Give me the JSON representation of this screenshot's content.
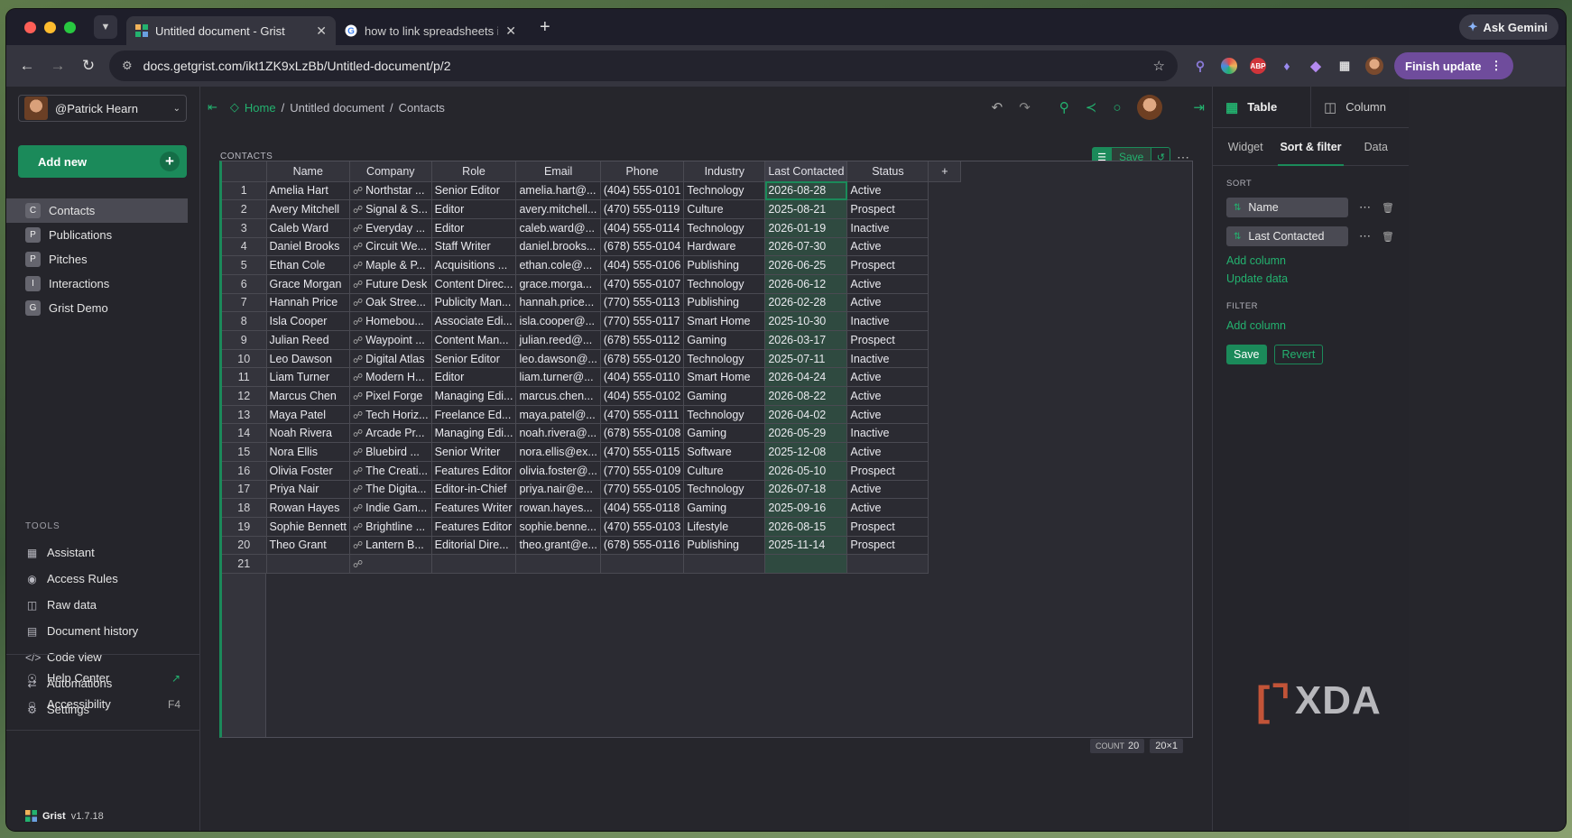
{
  "browser": {
    "tabs": [
      {
        "title": "Untitled document - Grist",
        "active": true
      },
      {
        "title": "how to link spreadsheets in g",
        "active": false
      }
    ],
    "gemini_label": "Ask Gemini",
    "url": "docs.getgrist.com/ikt1ZK9xLzBb/Untitled-document/p/2",
    "finish_update": "Finish update"
  },
  "left_panel": {
    "account": "@Patrick Hearn",
    "add_new": "Add new",
    "pages": [
      {
        "icon": "C",
        "label": "Contacts",
        "selected": true
      },
      {
        "icon": "P",
        "label": "Publications"
      },
      {
        "icon": "P",
        "label": "Pitches"
      },
      {
        "icon": "I",
        "label": "Interactions"
      },
      {
        "icon": "G",
        "label": "Grist Demo"
      }
    ],
    "tools_title": "TOOLS",
    "tools": [
      {
        "label": "Assistant"
      },
      {
        "label": "Access Rules"
      },
      {
        "label": "Raw data"
      },
      {
        "label": "Document history"
      },
      {
        "label": "Code view"
      },
      {
        "label": "Automations"
      },
      {
        "label": "Settings"
      }
    ],
    "help_center": "Help Center",
    "accessibility": "Accessibility",
    "accessibility_shortcut": "F4",
    "brand": "Grist",
    "version": "v1.7.18"
  },
  "breadcrumbs": {
    "home": "Home",
    "doc": "Untitled document",
    "page": "Contacts",
    "sep": "/"
  },
  "section": {
    "title": "CONTACTS",
    "save": "Save",
    "columns": [
      "Name",
      "Company",
      "Role",
      "Email",
      "Phone",
      "Industry",
      "Last Contacted",
      "Status"
    ],
    "add_column": "+",
    "rows": [
      [
        "1",
        "Amelia Hart",
        "Northstar ...",
        "Senior Editor",
        "amelia.hart@...",
        "(404) 555-0101",
        "Technology",
        "2026-08-28",
        "Active"
      ],
      [
        "2",
        "Avery Mitchell",
        "Signal & S...",
        "Editor",
        "avery.mitchell...",
        "(470) 555-0119",
        "Culture",
        "2025-08-21",
        "Prospect"
      ],
      [
        "3",
        "Caleb Ward",
        "Everyday ...",
        "Editor",
        "caleb.ward@...",
        "(404) 555-0114",
        "Technology",
        "2026-01-19",
        "Inactive"
      ],
      [
        "4",
        "Daniel Brooks",
        "Circuit We...",
        "Staff Writer",
        "daniel.brooks...",
        "(678) 555-0104",
        "Hardware",
        "2026-07-30",
        "Active"
      ],
      [
        "5",
        "Ethan Cole",
        "Maple & P...",
        "Acquisitions ...",
        "ethan.cole@...",
        "(404) 555-0106",
        "Publishing",
        "2026-06-25",
        "Prospect"
      ],
      [
        "6",
        "Grace Morgan",
        "Future Desk",
        "Content Direc...",
        "grace.morga...",
        "(470) 555-0107",
        "Technology",
        "2026-06-12",
        "Active"
      ],
      [
        "7",
        "Hannah Price",
        "Oak Stree...",
        "Publicity Man...",
        "hannah.price...",
        "(770) 555-0113",
        "Publishing",
        "2026-02-28",
        "Active"
      ],
      [
        "8",
        "Isla Cooper",
        "Homebou...",
        "Associate Edi...",
        "isla.cooper@...",
        "(770) 555-0117",
        "Smart Home",
        "2025-10-30",
        "Inactive"
      ],
      [
        "9",
        "Julian Reed",
        "Waypoint ...",
        "Content Man...",
        "julian.reed@...",
        "(678) 555-0112",
        "Gaming",
        "2026-03-17",
        "Prospect"
      ],
      [
        "10",
        "Leo Dawson",
        "Digital Atlas",
        "Senior Editor",
        "leo.dawson@...",
        "(678) 555-0120",
        "Technology",
        "2025-07-11",
        "Inactive"
      ],
      [
        "11",
        "Liam Turner",
        "Modern H...",
        "Editor",
        "liam.turner@...",
        "(404) 555-0110",
        "Smart Home",
        "2026-04-24",
        "Active"
      ],
      [
        "12",
        "Marcus Chen",
        "Pixel Forge",
        "Managing Edi...",
        "marcus.chen...",
        "(404) 555-0102",
        "Gaming",
        "2026-08-22",
        "Active"
      ],
      [
        "13",
        "Maya Patel",
        "Tech Horiz...",
        "Freelance Ed...",
        "maya.patel@...",
        "(470) 555-0111",
        "Technology",
        "2026-04-02",
        "Active"
      ],
      [
        "14",
        "Noah Rivera",
        "Arcade Pr...",
        "Managing Edi...",
        "noah.rivera@...",
        "(678) 555-0108",
        "Gaming",
        "2026-05-29",
        "Inactive"
      ],
      [
        "15",
        "Nora Ellis",
        "Bluebird ...",
        "Senior Writer",
        "nora.ellis@ex...",
        "(470) 555-0115",
        "Software",
        "2025-12-08",
        "Active"
      ],
      [
        "16",
        "Olivia Foster",
        "The Creati...",
        "Features Editor",
        "olivia.foster@...",
        "(770) 555-0109",
        "Culture",
        "2026-05-10",
        "Prospect"
      ],
      [
        "17",
        "Priya Nair",
        "The Digita...",
        "Editor-in-Chief",
        "priya.nair@e...",
        "(770) 555-0105",
        "Technology",
        "2026-07-18",
        "Active"
      ],
      [
        "18",
        "Rowan Hayes",
        "Indie Gam...",
        "Features Writer",
        "rowan.hayes...",
        "(404) 555-0118",
        "Gaming",
        "2025-09-16",
        "Active"
      ],
      [
        "19",
        "Sophie Bennett",
        "Brightline ...",
        "Features Editor",
        "sophie.benne...",
        "(470) 555-0103",
        "Lifestyle",
        "2026-08-15",
        "Prospect"
      ],
      [
        "20",
        "Theo Grant",
        "Lantern B...",
        "Editorial Dire...",
        "theo.grant@e...",
        "(678) 555-0116",
        "Publishing",
        "2025-11-14",
        "Prospect"
      ]
    ],
    "new_row_number": "21",
    "count_label": "COUNT",
    "count_value": "20",
    "selection_size": "20×1"
  },
  "right_panel": {
    "table_tab": "Table",
    "column_tab": "Column",
    "subtabs": [
      "Widget",
      "Sort & filter",
      "Data"
    ],
    "sort_title": "SORT",
    "sort_items": [
      "Name",
      "Last Contacted"
    ],
    "add_column": "Add column",
    "update_data": "Update data",
    "filter_title": "FILTER",
    "filter_add_column": "Add column",
    "save": "Save",
    "revert": "Revert"
  },
  "watermark": "XDA",
  "colors": {
    "accent": "#1b8a5a",
    "accent_text": "#23b26f",
    "panel": "#25252b",
    "grid_bg": "#2b2b32"
  }
}
